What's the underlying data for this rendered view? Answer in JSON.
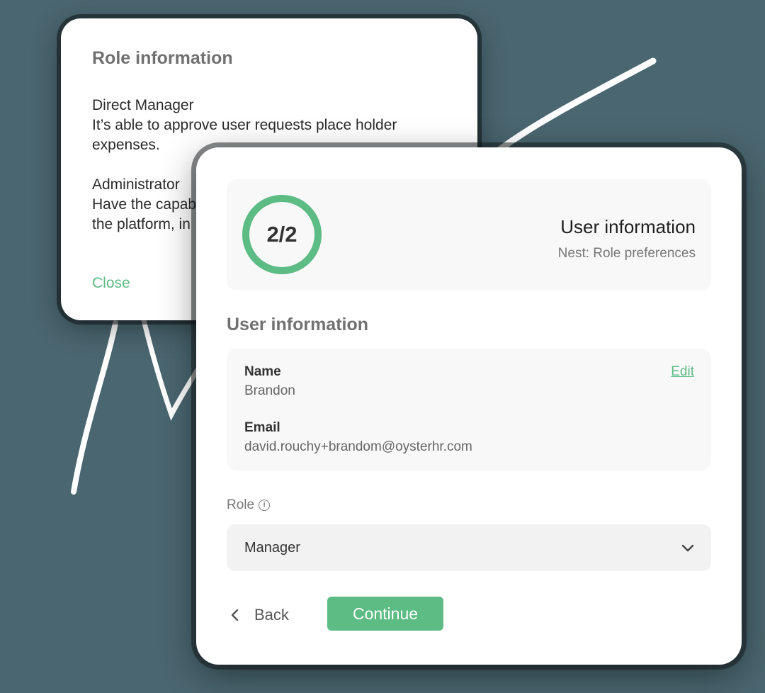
{
  "role_info": {
    "title": "Role information",
    "entries": [
      {
        "name": "Direct Manager",
        "description": "It’s able to approve user requests place holder expenses."
      },
      {
        "name": "Administrator",
        "description": "Have the capab... the platform, i..."
      }
    ],
    "admin_line1": "Have the capab",
    "admin_line2": "the platform, in",
    "close_label": "Close"
  },
  "progress": {
    "label": "2/2",
    "value": 1.0,
    "heading": "User information",
    "subheading": "Nest: Role preferences"
  },
  "user_info": {
    "section_title": "User information",
    "edit_label": "Edit",
    "name_label": "Name",
    "name_value": "Brandon",
    "email_label": "Email",
    "email_value": "david.rouchy+brandom@oysterhr.com"
  },
  "role": {
    "label": "Role",
    "selected": "Manager"
  },
  "actions": {
    "back_label": "Back",
    "continue_label": "Continue"
  },
  "colors": {
    "accent": "#5dbb84",
    "background": "#4a6670"
  }
}
